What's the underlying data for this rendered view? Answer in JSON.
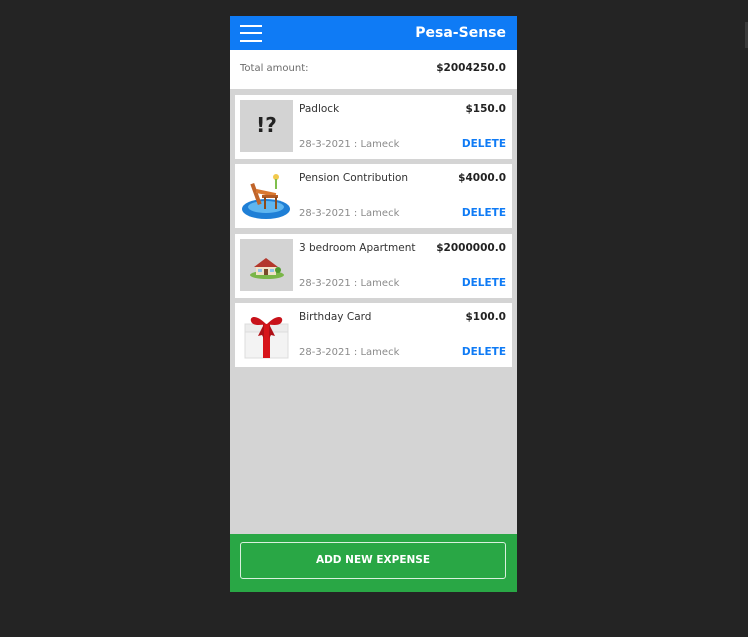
{
  "header": {
    "title": "Pesa-Sense",
    "menu_icon": "hamburger-menu-icon"
  },
  "summary": {
    "label": "Total amount:",
    "value": "$2004250.0"
  },
  "expenses": [
    {
      "name": "Padlock",
      "price": "$150.0",
      "meta": "28-3-2021 : Lameck",
      "delete_label": "DELETE",
      "thumb_text": "!?",
      "thumb_icon": "unknown-image-icon"
    },
    {
      "name": "Pension Contribution",
      "price": "$4000.0",
      "meta": "28-3-2021 : Lameck",
      "delete_label": "DELETE",
      "thumb_icon": "beach-chair-icon"
    },
    {
      "name": "3 bedroom Apartment",
      "price": "$2000000.0",
      "meta": "28-3-2021 : Lameck",
      "delete_label": "DELETE",
      "thumb_icon": "house-icon"
    },
    {
      "name": "Birthday Card",
      "price": "$100.0",
      "meta": "28-3-2021 : Lameck",
      "delete_label": "DELETE",
      "thumb_icon": "gift-box-icon"
    }
  ],
  "footer": {
    "add_label": "ADD NEW EXPENSE"
  },
  "colors": {
    "header": "#0f7bf5",
    "footer": "#29a745",
    "list_bg": "#d4d4d4",
    "delete": "#0f7bf5"
  }
}
